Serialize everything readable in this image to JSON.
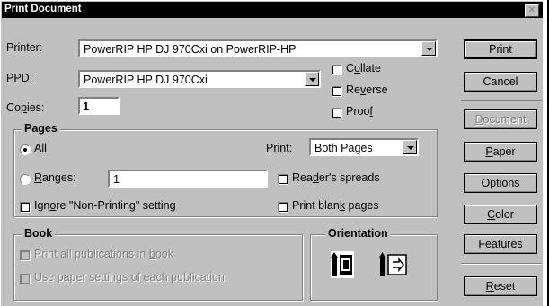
{
  "window": {
    "title": "Print Document",
    "close_label": "✕"
  },
  "printer": {
    "label": "Printer:",
    "value": "PowerRIP HP DJ 970Cxi on PowerRIP-HP"
  },
  "ppd": {
    "label": "PPD:",
    "value": "PowerRIP HP DJ 970Cxi"
  },
  "copies": {
    "label_pre": "Co",
    "label_u": "p",
    "label_post": "ies:",
    "value": "1"
  },
  "options": {
    "collate": {
      "pre": "C",
      "u": "o",
      "post": "llate",
      "checked": false
    },
    "reverse": {
      "pre": "Re",
      "u": "v",
      "post": "erse",
      "checked": false
    },
    "proof": {
      "pre": "Proo",
      "u": "f",
      "post": "",
      "checked": false
    }
  },
  "pages": {
    "group_label": "Pages",
    "all": {
      "pre": "",
      "u": "A",
      "post": "ll",
      "selected": true
    },
    "ranges": {
      "pre": "",
      "u": "R",
      "post": "anges:",
      "value": "1",
      "selected": false
    },
    "print": {
      "pre": "Pri",
      "u": "n",
      "post": "t:",
      "value": "Both Pages"
    },
    "readers_spreads": {
      "pre": "Rea",
      "u": "d",
      "post": "er's spreads",
      "checked": false
    },
    "ignore_nonprinting": {
      "pre": "Ign",
      "u": "o",
      "post": "re \"Non-Printing\" setting",
      "checked": false
    },
    "blank_pages": {
      "pre": "Print blan",
      "u": "k",
      "post": " pages",
      "checked": false
    }
  },
  "book": {
    "group_label": "Book",
    "print_all": {
      "pre": "Print all publications in ",
      "u": "b",
      "post": "ook"
    },
    "use_paper": {
      "pre": "Use paper settin",
      "u": "g",
      "post": "s of each publication"
    }
  },
  "orientation": {
    "group_label": "Orientation",
    "portrait_icon": "portrait-orientation-icon",
    "landscape_icon": "landscape-orientation-icon"
  },
  "buttons": {
    "print": "Print",
    "cancel": "Cancel",
    "document": {
      "pre": "",
      "u": "D",
      "post": "ocument"
    },
    "paper": {
      "pre": "",
      "u": "P",
      "post": "aper"
    },
    "options": {
      "pre": "Op",
      "u": "t",
      "post": "ions"
    },
    "color": {
      "pre": "",
      "u": "C",
      "post": "olor"
    },
    "features": {
      "pre": "Feat",
      "u": "u",
      "post": "res"
    },
    "reset": {
      "pre": "",
      "u": "R",
      "post": "eset"
    }
  }
}
